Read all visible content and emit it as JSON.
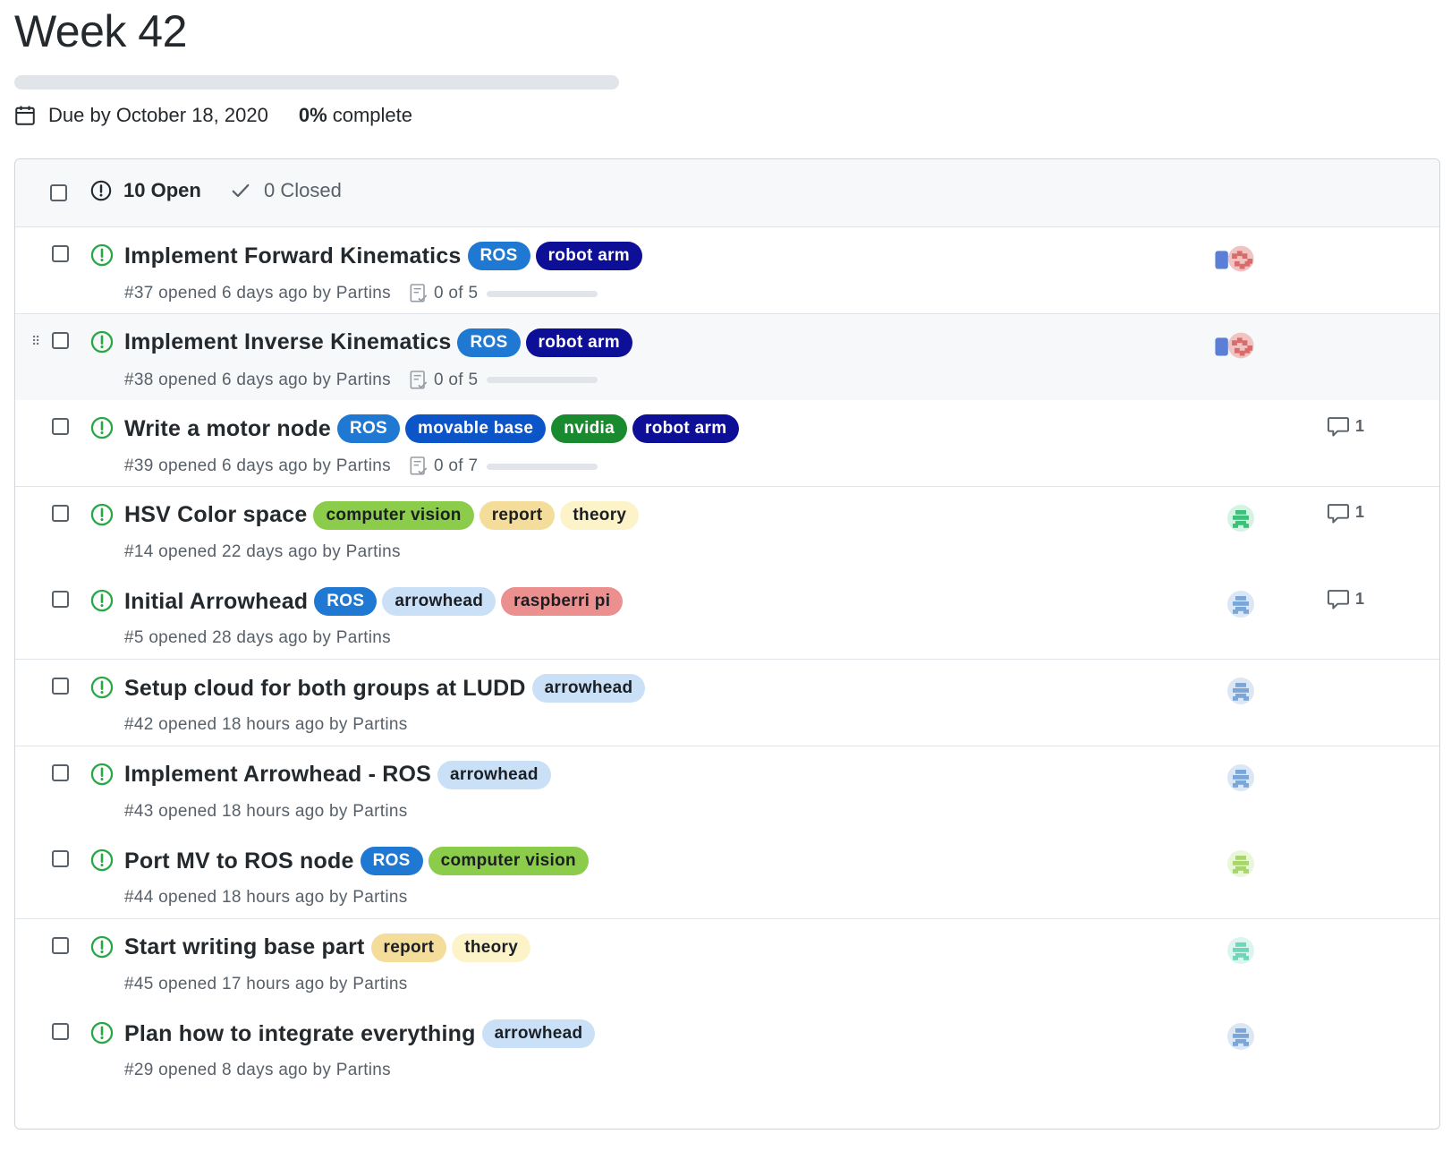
{
  "milestone": {
    "title": "Week 42",
    "progress_percent": 0,
    "due_text": "Due by October 18, 2020",
    "percent_value": "0%",
    "percent_suffix": "complete"
  },
  "header": {
    "open_label": "10 Open",
    "closed_label": "0 Closed"
  },
  "colors": {
    "open_status": "#28a745",
    "label_ros": "#1f78d1",
    "label_robot_arm": "#0d0f96",
    "label_movable_base": "#0b55c9",
    "label_nvidia": "#1a8a2e",
    "label_computer_vision": "#8bcc4a",
    "label_report": "#f4dc9a",
    "label_theory": "#fdf3c8",
    "label_arrowhead": "#c9e0f7",
    "label_raspberry_pi": "#eb8f8f"
  },
  "issues": [
    {
      "title": "Implement Forward Kinematics",
      "labels": [
        "ROS",
        "robot arm"
      ],
      "meta": "#37 opened 6 days ago by Partins",
      "tasks": "0 of 5",
      "tasks_done": 0,
      "tasks_total": 5,
      "avatar": "avatar-pair-blue-red",
      "comments": null
    },
    {
      "title": "Implement Inverse Kinematics",
      "labels": [
        "ROS",
        "robot arm"
      ],
      "meta": "#38 opened 6 days ago by Partins",
      "tasks": "0 of 5",
      "tasks_done": 0,
      "tasks_total": 5,
      "avatar": "avatar-pair-blue-red",
      "comments": null
    },
    {
      "title": "Write a motor node",
      "labels": [
        "ROS",
        "movable base",
        "nvidia",
        "robot arm"
      ],
      "meta": "#39 opened 6 days ago by Partins",
      "tasks": "0 of 7",
      "tasks_done": 0,
      "tasks_total": 7,
      "avatar": null,
      "comments": "1"
    },
    {
      "title": "HSV Color space",
      "labels": [
        "computer vision",
        "report",
        "theory"
      ],
      "meta": "#14 opened 22 days ago by Partins",
      "tasks": null,
      "avatar": "avatar-green",
      "comments": "1"
    },
    {
      "title": "Initial Arrowhead",
      "labels": [
        "ROS",
        "arrowhead",
        "raspberri pi"
      ],
      "meta": "#5 opened 28 days ago by Partins",
      "tasks": null,
      "avatar": "avatar-blue",
      "comments": "1"
    },
    {
      "title": "Setup cloud for both groups at LUDD",
      "labels": [
        "arrowhead"
      ],
      "meta": "#42 opened 18 hours ago by Partins",
      "tasks": null,
      "avatar": "avatar-blue",
      "comments": null
    },
    {
      "title": "Implement Arrowhead - ROS",
      "labels": [
        "arrowhead"
      ],
      "meta": "#43 opened 18 hours ago by Partins",
      "tasks": null,
      "avatar": "avatar-blue",
      "comments": null
    },
    {
      "title": "Port MV to ROS node",
      "labels": [
        "ROS",
        "computer vision"
      ],
      "meta": "#44 opened 18 hours ago by Partins",
      "tasks": null,
      "avatar": "avatar-lime",
      "comments": null
    },
    {
      "title": "Start writing base part",
      "labels": [
        "report",
        "theory"
      ],
      "meta": "#45 opened 17 hours ago by Partins",
      "tasks": null,
      "avatar": "avatar-teal",
      "comments": null
    },
    {
      "title": "Plan how to integrate everything",
      "labels": [
        "arrowhead"
      ],
      "meta": "#29 opened 8 days ago by Partins",
      "tasks": null,
      "avatar": "avatar-blue",
      "comments": null
    }
  ]
}
